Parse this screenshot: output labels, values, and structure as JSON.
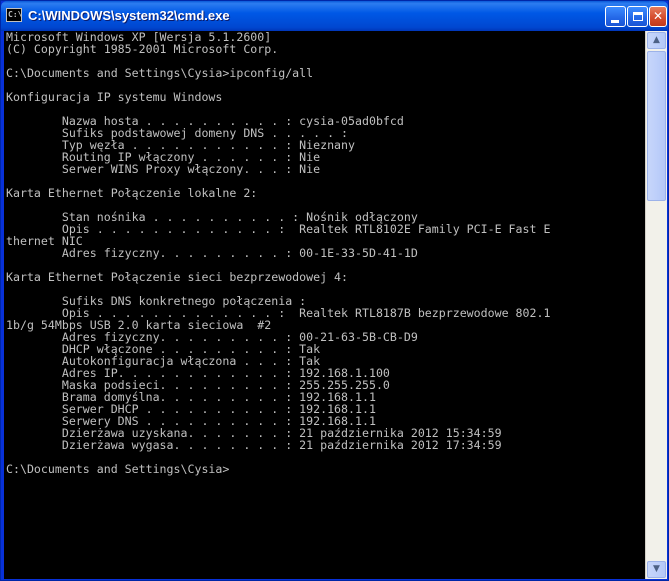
{
  "window": {
    "title": "C:\\WINDOWS\\system32\\cmd.exe",
    "icon_label": "C:\\",
    "min_glyph": "_",
    "close_glyph": "✕"
  },
  "scrollbar": {
    "up_arrow": "▲",
    "down_arrow": "▼"
  },
  "console": {
    "lines": [
      "Microsoft Windows XP [Wersja 5.1.2600]",
      "(C) Copyright 1985-2001 Microsoft Corp.",
      "",
      "C:\\Documents and Settings\\Cysia>ipconfig/all",
      "",
      "Konfiguracja IP systemu Windows",
      "",
      "        Nazwa hosta . . . . . . . . . . : cysia-05ad0bfcd",
      "        Sufiks podstawowej domeny DNS . . . . . :",
      "        Typ węzła . . . . . . . . . . . : Nieznany",
      "        Routing IP włączony . . . . . . : Nie",
      "        Serwer WINS Proxy włączony. . . : Nie",
      "",
      "Karta Ethernet Połączenie lokalne 2:",
      "",
      "        Stan nośnika . . . . . . . . . . : Nośnik odłączony",
      "        Opis . . . . . . . . . . . . . :  Realtek RTL8102E Family PCI-E Fast E",
      "thernet NIC",
      "        Adres fizyczny. . . . . . . . . : 00-1E-33-5D-41-1D",
      "",
      "Karta Ethernet Połączenie sieci bezprzewodowej 4:",
      "",
      "        Sufiks DNS konkretnego połączenia :",
      "        Opis . . . . . . . . . . . . . :  Realtek RTL8187B bezprzewodowe 802.1",
      "1b/g 54Mbps USB 2.0 karta sieciowa  #2",
      "        Adres fizyczny. . . . . . . . . : 00-21-63-5B-CB-D9",
      "        DHCP włączone . . . . . . . . . : Tak",
      "        Autokonfiguracja włączona . . . : Tak",
      "        Adres IP. . . . . . . . . . . . : 192.168.1.100",
      "        Maska podsieci. . . . . . . . . : 255.255.255.0",
      "        Brama domyślna. . . . . . . . . : 192.168.1.1",
      "        Serwer DHCP . . . . . . . . . . : 192.168.1.1",
      "        Serwery DNS . . . . . . . . . . : 192.168.1.1",
      "        Dzierżawa uzyskana. . . . . . . : 21 października 2012 15:34:59",
      "        Dzierżawa wygasa. . . . . . . . : 21 października 2012 17:34:59",
      "",
      "C:\\Documents and Settings\\Cysia>"
    ]
  }
}
